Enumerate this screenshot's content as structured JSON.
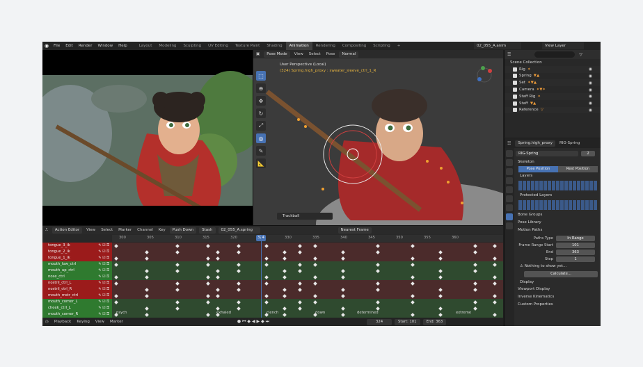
{
  "menu": [
    "File",
    "Edit",
    "Render",
    "Window",
    "Help"
  ],
  "workspaces": [
    "Layout",
    "Modeling",
    "Sculpting",
    "UV Editing",
    "Texture Paint",
    "Shading",
    "Animation",
    "Rendering",
    "Compositing",
    "Scripting",
    "+"
  ],
  "active_workspace": "Animation",
  "scene_name": "02_055_A.anim",
  "view_layer": "View Layer",
  "viewport": {
    "mode": "Pose Mode",
    "menus": [
      "View",
      "Select",
      "Pose"
    ],
    "transform_orientation": "Normal",
    "info_line1": "User Perspective (Local)",
    "info_line2": "(324) Spring.high_proxy : sweater_sleeve_ctrl_1_R",
    "trackball_label": "Trackball"
  },
  "outliner": {
    "title": "Scene Collection",
    "rows": [
      "Rig",
      "Spring",
      "Set",
      "Camera",
      "Staff Rig",
      "Staff",
      "Reference"
    ]
  },
  "properties": {
    "object": "Spring.high_proxy",
    "rig_tab": "RIG-Spring",
    "armature_name": "RIG-Spring",
    "users": "2",
    "skeleton": "Skeleton",
    "pose_position": "Pose Position",
    "rest_position": "Rest Position",
    "layers": "Layers",
    "protected_layers": "Protected Layers",
    "bone_groups": "Bone Groups",
    "pose_library": "Pose Library",
    "motion_paths": "Motion Paths",
    "paths_type_label": "Paths Type",
    "paths_type_value": "In Range",
    "frame_start_label": "Frame Range Start",
    "frame_start": "101",
    "end_label": "End",
    "end_value": "363",
    "step_label": "Step",
    "step_value": "1",
    "warning": "Nothing to show yet...",
    "calculate": "Calculate...",
    "display": "Display",
    "viewport_display": "Viewport Display",
    "inverse_kinematics": "Inverse Kinematics",
    "custom_properties": "Custom Properties"
  },
  "action_editor": {
    "mode": "Action Editor",
    "menus": [
      "View",
      "Select",
      "Marker",
      "Channel",
      "Key"
    ],
    "push_down": "Push Down",
    "stash": "Stash",
    "action": "02_055_A.spring",
    "snap": "Nearest Frame",
    "ticks": [
      "300",
      "305",
      "310",
      "315",
      "320",
      "324",
      "330",
      "335",
      "340",
      "345",
      "350",
      "355",
      "360"
    ],
    "current_frame": "324",
    "channels": [
      {
        "name": "tongue_3_ik",
        "color": "red"
      },
      {
        "name": "tongue_2_ik",
        "color": "red"
      },
      {
        "name": "tongue_1_ik",
        "color": "red"
      },
      {
        "name": "mouth_low_ctrl",
        "color": "green"
      },
      {
        "name": "mouth_up_ctrl",
        "color": "green"
      },
      {
        "name": "nose_ctrl",
        "color": "green"
      },
      {
        "name": "nostril_ctrl_L",
        "color": "red"
      },
      {
        "name": "nostril_ctrl_R",
        "color": "red"
      },
      {
        "name": "mouth_mstr_ctrl",
        "color": "red"
      },
      {
        "name": "mouth_corner_L",
        "color": "green"
      },
      {
        "name": "cheek_ctrl_L",
        "color": "green"
      },
      {
        "name": "mouth_corner_R",
        "color": "green"
      }
    ],
    "markers": [
      "psych",
      "exhaled",
      "clench",
      "down",
      "determined",
      "extreme"
    ]
  },
  "timeline": {
    "menus": [
      "Playback",
      "Keying",
      "View",
      "Marker"
    ],
    "frame": "324",
    "start_label": "Start:",
    "start": "101",
    "end_label": "End:",
    "end": "363"
  }
}
